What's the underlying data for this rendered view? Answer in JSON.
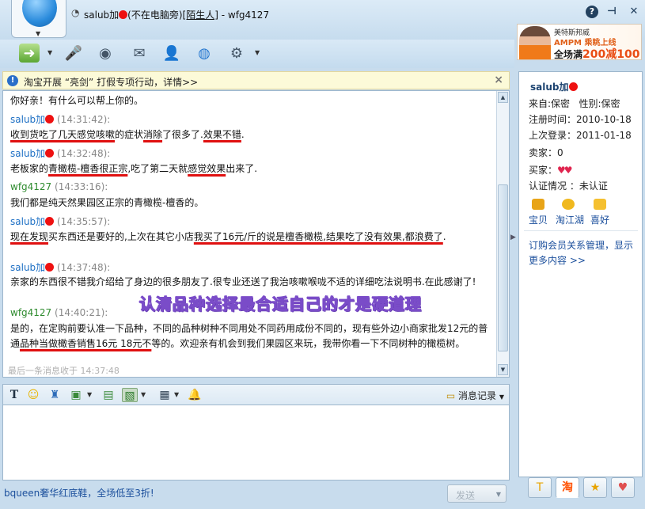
{
  "window": {
    "title": "salub加",
    "title_status": "(不在电脑旁)",
    "title_group": "[陌生人]",
    "title_self": " - wfg4127",
    "help_icon": "help-icon",
    "pin_icon": "pin-icon",
    "close_icon": "close-icon"
  },
  "ad": {
    "line1": "美特斯邦威",
    "line2": "AMPM 乘眺上线",
    "line3_prefix": "全场满",
    "line3_highlight": "200减100"
  },
  "notice": {
    "text": "淘宝开展 “亮剑” 打假专项行动，详情>>",
    "close_label": "×"
  },
  "messages": [
    {
      "text_parts": [
        {
          "t": "你好亲！有什么可以帮上你的。"
        }
      ]
    },
    {
      "sender": "salub加",
      "time": "(14:31:42):",
      "role": "other",
      "text_parts": [
        {
          "t": "收到货吃了几天感觉咳嗽",
          "u": true
        },
        {
          "t": "的症状"
        },
        {
          "t": "消除",
          "u": true
        },
        {
          "t": "了很多了."
        },
        {
          "t": "效果不错",
          "u": true
        },
        {
          "t": "."
        }
      ]
    },
    {
      "sender": "salub加",
      "time": "(14:32:48):",
      "role": "other",
      "text_parts": [
        {
          "t": "老板家的"
        },
        {
          "t": "青橄榄-檀香很正宗",
          "u": true
        },
        {
          "t": ",吃了第二天就"
        },
        {
          "t": "感觉效果",
          "u": true
        },
        {
          "t": "出来了."
        }
      ]
    },
    {
      "sender": "wfg4127",
      "time": "(14:33:16):",
      "role": "self",
      "text_parts": [
        {
          "t": "我们都是纯天然果园区正宗的青橄榄-檀香的。"
        }
      ]
    },
    {
      "sender": "salub加",
      "time": "(14:35:57):",
      "role": "other",
      "text_parts": [
        {
          "t": "现在发现",
          "u": true
        },
        {
          "t": "买东西还是要好的,上次在其它小店"
        },
        {
          "t": "我买了16元/斤的说是檀香橄榄,结果吃了没有效果,都浪费了",
          "u": true
        },
        {
          "t": "."
        }
      ]
    },
    {
      "sender": "salub加",
      "time": "(14:37:48):",
      "role": "other",
      "text_parts": [
        {
          "t": "亲家的东西很不错我介绍给了身边的很多朋友了.很专业还送了我治咳嗽喉咙不适的详细吃法说明书.在此感谢了!"
        }
      ]
    },
    {
      "sender": "wfg4127",
      "time": "(14:40:21):",
      "role": "self",
      "text_parts": [
        {
          "t": "是的，在定购前要认准一下品种，不同的品种树种不同用处不同药用成份不同的，现有些外边小商家批发12元的普通"
        },
        {
          "t": "品种当做橄香销售16元 18元不",
          "u": true
        },
        {
          "t": "等的。欢迎亲有机会到我们果园区来玩，我带你看一下不同树种的橄榄树。"
        }
      ]
    }
  ],
  "overlay_caption": "认清品种选择最合适自己的才是硬道理",
  "last_message": "最后一条消息收于 14:37:48",
  "format_toolbar": {
    "history_label": "消息记录"
  },
  "bottom": {
    "promo_link": "bqueen奢华红底鞋，全场低至3折!",
    "send_label": "发送"
  },
  "profile": {
    "name": "salub加",
    "location": "来自:保密",
    "gender": "性别:保密",
    "registered": "注册时间：2010-10-18",
    "last_login": "上次登录：2011-01-18",
    "seller_rating": "卖家：0",
    "buyer_rating": "买家：",
    "certification": "认证情况 ：未认证",
    "links": [
      {
        "label": "宝贝",
        "color": "#e8a418"
      },
      {
        "label": "淘江湖",
        "color": "#f0b81e"
      },
      {
        "label": "喜好",
        "color": "#f5c030"
      }
    ],
    "membership_line1": "订购会员关系管理，显示",
    "membership_line2": "更多内容 >>"
  },
  "side_tabs": [
    {
      "label": "T"
    },
    {
      "label": "淘"
    },
    {
      "label": "★"
    },
    {
      "label": "♥"
    }
  ],
  "colors": {
    "underline_red": "#e01010",
    "sender_other": "#1d6fc4",
    "sender_self": "#2e8b2e",
    "link": "#1b4f9c"
  }
}
